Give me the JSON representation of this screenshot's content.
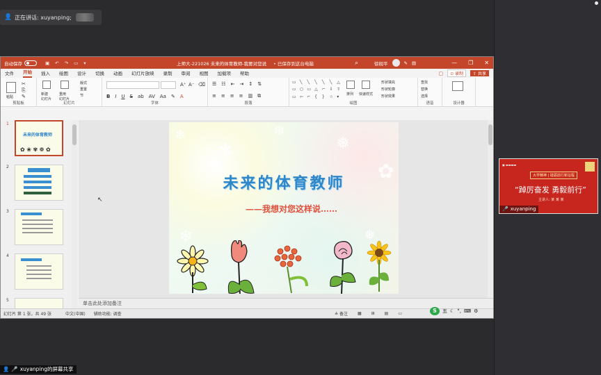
{
  "meeting": {
    "speaker_text": "正在讲话: xuyanping;",
    "share_label": "xuyanping的屏幕共享",
    "participant_name": "xuyanping",
    "thumb_sub": "大学精神 | 砥砺前行新征程",
    "thumb_main": "“踔厉奋发 勇毅前行”",
    "thumb_small": "主讲人: 某 某 某"
  },
  "ppt": {
    "autosave": "自动保存",
    "toggle": "关",
    "doc_title": "上师大-221026 未来的体育教师-我要对您说",
    "saved_state": "• 已保存到这台电脑",
    "user": "徐砚平",
    "tabs": [
      "文件",
      "开始",
      "插入",
      "绘图",
      "设计",
      "切换",
      "动画",
      "幻灯片放映",
      "录制",
      "审阅",
      "视图",
      "加载项",
      "帮助"
    ],
    "active_tab": "开始",
    "record_btn": "录制",
    "share_btn": "共享",
    "groups": {
      "clipboard": "剪贴板",
      "slides": "幻灯片",
      "font": "字体",
      "paragraph": "段落",
      "drawing": "绘图",
      "voice": "语音",
      "designer": "设计器"
    },
    "ribbon_labels": {
      "paste": "粘贴",
      "new_slide": "新建\n幻灯片",
      "reuse": "重用\n幻灯片",
      "layout": "版式",
      "reset": "重置",
      "section": "节",
      "arrange": "排列",
      "quick_styles": "快速样式",
      "fill": "形状填充",
      "outline": "形状轮廓",
      "effects": "形状效果",
      "find": "查找",
      "replace": "替换",
      "select": "选择"
    },
    "slide": {
      "title": "未来的体育教师",
      "subtitle": "——我想对您这样说……"
    },
    "thumb_numbers": [
      "1",
      "2",
      "3",
      "4",
      "5"
    ],
    "thumb1_title": "未来的体育教师",
    "notes_placeholder": "单击此处添加备注",
    "status": {
      "slide_count": "幻灯片 第 1 张，共 49 张",
      "language": "中文(中国)",
      "accessibility": "辅助功能: 调查",
      "notes": "备注"
    },
    "ime": [
      "S",
      "五",
      "☾",
      "°,",
      "⌨",
      "⚙"
    ]
  },
  "colors": {
    "accent": "#c4462a",
    "title_blue": "#2f86c8",
    "subtitle_red": "#e0503c",
    "thumb_bg": "#c7261e"
  }
}
